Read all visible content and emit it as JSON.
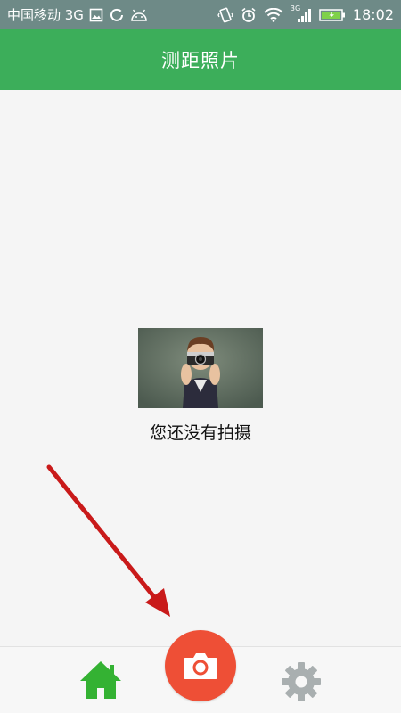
{
  "status_bar": {
    "carrier": "中国移动 3G",
    "network_badge": "3G",
    "time": "18:02",
    "icons": [
      "image-icon",
      "sync-icon",
      "android-icon",
      "vibrate-icon",
      "alarm-icon",
      "wifi-icon",
      "signal-icon",
      "battery-icon"
    ]
  },
  "app_bar": {
    "title": "测距照片"
  },
  "empty_state": {
    "message": "您还没有拍摄"
  },
  "bottom_nav": {
    "items": [
      "home-icon",
      "camera-icon",
      "settings-icon"
    ]
  },
  "colors": {
    "app_bar": "#3cae5a",
    "home": "#34b233",
    "camera": "#ee4f36",
    "settings": "#a9afb0",
    "arrow": "#c91a1a"
  }
}
